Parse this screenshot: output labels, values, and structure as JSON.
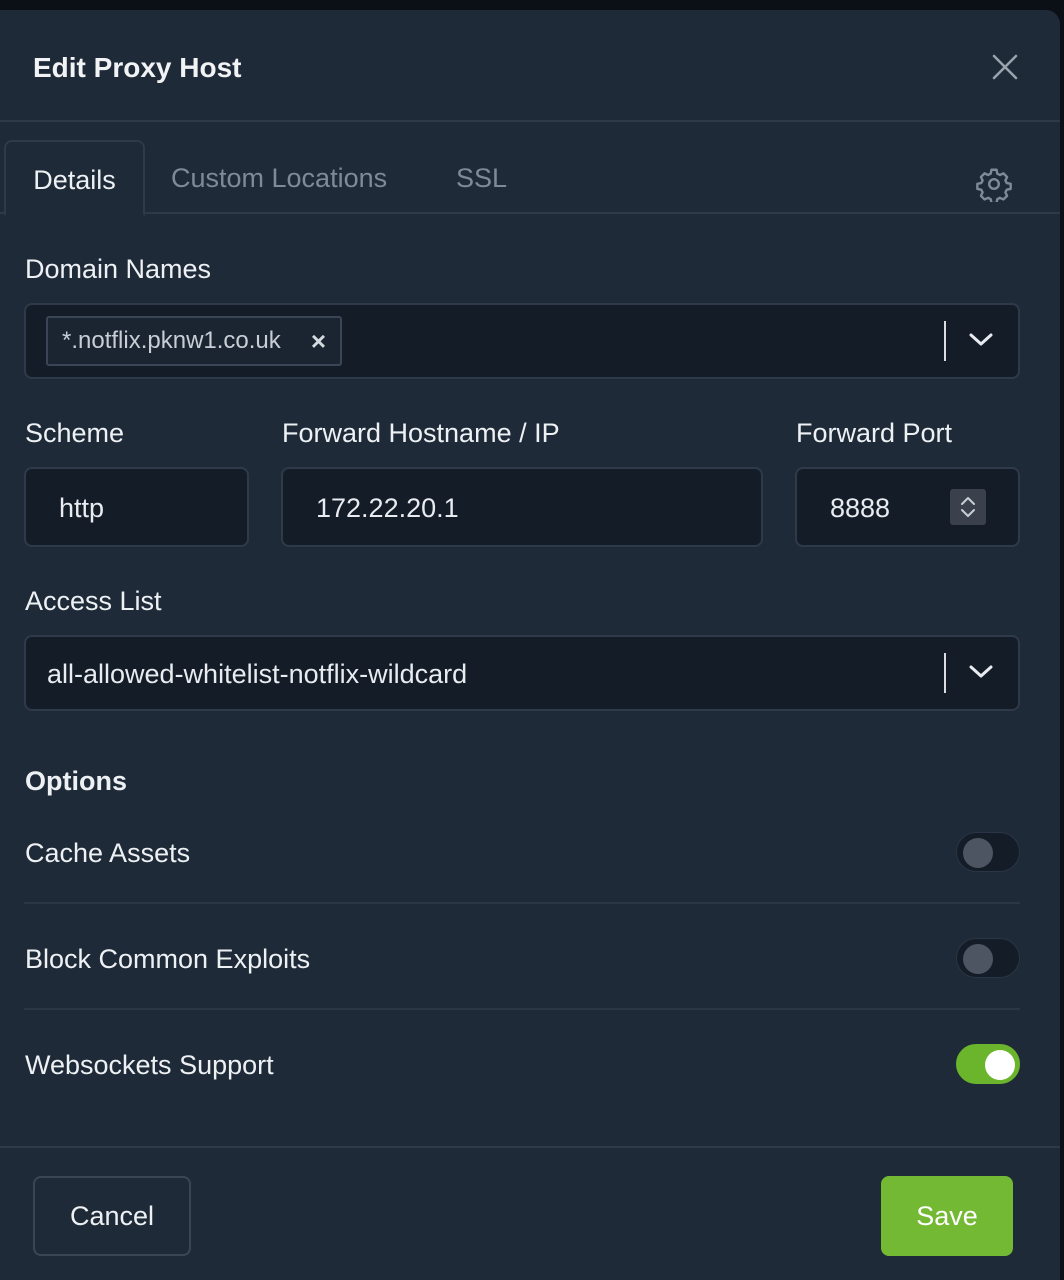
{
  "modal": {
    "title": "Edit Proxy Host"
  },
  "tabs": [
    {
      "label": "Details",
      "active": true
    },
    {
      "label": "Custom Locations",
      "active": false
    },
    {
      "label": "SSL",
      "active": false
    }
  ],
  "form": {
    "domain_names": {
      "label": "Domain Names",
      "chips": [
        "*.notflix.pknw1.co.uk"
      ]
    },
    "scheme": {
      "label": "Scheme",
      "value": "http"
    },
    "forward_host": {
      "label": "Forward Hostname / IP",
      "value": "172.22.20.1"
    },
    "forward_port": {
      "label": "Forward Port",
      "value": "8888"
    },
    "access_list": {
      "label": "Access List",
      "value": "all-allowed-whitelist-notflix-wildcard"
    }
  },
  "options": {
    "heading": "Options",
    "items": [
      {
        "label": "Cache Assets",
        "enabled": false
      },
      {
        "label": "Block Common Exploits",
        "enabled": false
      },
      {
        "label": "Websockets Support",
        "enabled": true
      }
    ]
  },
  "footer": {
    "cancel_label": "Cancel",
    "save_label": "Save"
  },
  "colors": {
    "accent": "#74b934",
    "panel": "#1f2a38",
    "input_bg": "#141c28"
  }
}
